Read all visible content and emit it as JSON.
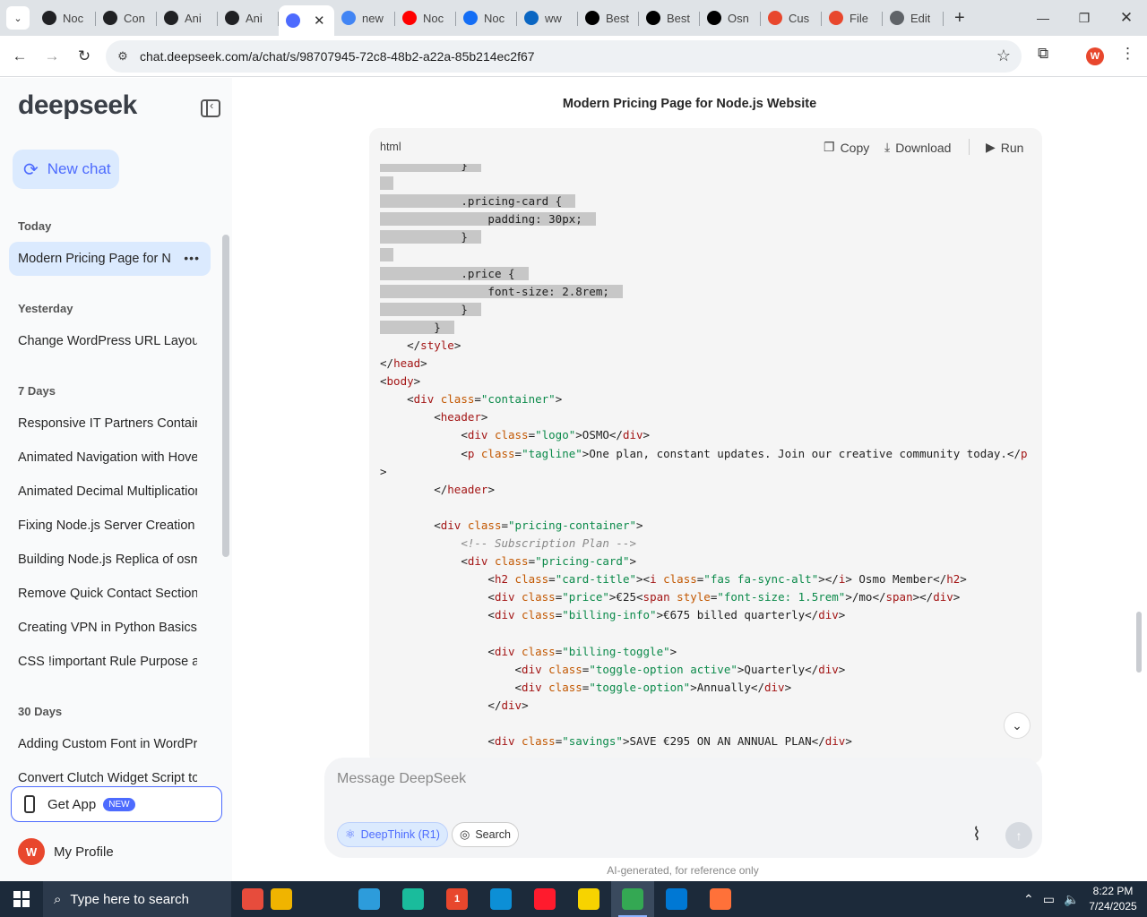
{
  "browser": {
    "tabs": [
      {
        "label": "Noc",
        "icon": "openai-icon",
        "color": "#202124"
      },
      {
        "label": "Con",
        "icon": "openai-icon",
        "color": "#202124"
      },
      {
        "label": "Ani",
        "icon": "openai-icon",
        "color": "#202124"
      },
      {
        "label": "Ani",
        "icon": "openai-icon",
        "color": "#202124"
      },
      {
        "label": "",
        "icon": "deepseek-icon",
        "color": "#4d6bfe",
        "active": true
      },
      {
        "label": "new",
        "icon": "google-icon",
        "color": "#4285f4"
      },
      {
        "label": "Noc",
        "icon": "youtube-icon",
        "color": "#ff0000"
      },
      {
        "label": "Noc",
        "icon": "webflow-icon",
        "color": "#146ef5"
      },
      {
        "label": "ww",
        "icon": "linkedin-icon",
        "color": "#0a66c2"
      },
      {
        "label": "Best",
        "icon": "x-icon",
        "color": "#000000"
      },
      {
        "label": "Best",
        "icon": "x-icon",
        "color": "#000000"
      },
      {
        "label": "Osn",
        "icon": "osmo-icon",
        "color": "#000000"
      },
      {
        "label": "Cus",
        "icon": "figma-icon",
        "color": "#e8472d"
      },
      {
        "label": "File",
        "icon": "figma-icon",
        "color": "#e8472d"
      },
      {
        "label": "Edit",
        "icon": "globe-icon",
        "color": "#5f6368"
      }
    ],
    "url": "chat.deepseek.com/a/chat/s/98707945-72c8-48b2-a22a-85b214ec2f67",
    "profile_initial": "W"
  },
  "sidebar": {
    "brand": "deepseek",
    "new_chat": "New chat",
    "sections": [
      {
        "title": "Today",
        "items": [
          "Modern Pricing Page for Node.js Website"
        ]
      },
      {
        "title": "Yesterday",
        "items": [
          "Change WordPress URL Layout Guide"
        ]
      },
      {
        "title": "7 Days",
        "items": [
          "Responsive IT Partners Container",
          "Animated Navigation with Hover",
          "Animated Decimal Multiplication",
          "Fixing Node.js Server Creation Error",
          "Building Node.js Replica of osmo",
          "Remove Quick Contact Section in",
          "Creating VPN in Python Basics",
          "CSS !important Rule Purpose and"
        ]
      },
      {
        "title": "30 Days",
        "items": [
          "Adding Custom Font in WordPress",
          "Convert Clutch Widget Script to"
        ]
      }
    ],
    "active_item": "Modern Pricing Page for Node.js Website",
    "get_app": "Get App",
    "get_app_badge": "NEW",
    "profile_name": "My Profile",
    "profile_initial": "W"
  },
  "main": {
    "title": "Modern Pricing Page for Node.js Website",
    "code": {
      "language": "html",
      "copy": "Copy",
      "download": "Download",
      "run": "Run",
      "lines": [
        {
          "indent": 12,
          "sel": true,
          "tokens": [
            {
              "t": "}",
              "c": ""
            }
          ]
        },
        {
          "indent": 0,
          "sel": true,
          "tokens": [
            {
              "t": "",
              "c": ""
            }
          ]
        },
        {
          "indent": 12,
          "sel": true,
          "tokens": [
            {
              "t": ".pricing-card {",
              "c": ""
            }
          ]
        },
        {
          "indent": 16,
          "sel": true,
          "tokens": [
            {
              "t": "padding: 30px;",
              "c": ""
            }
          ]
        },
        {
          "indent": 12,
          "sel": true,
          "tokens": [
            {
              "t": "}",
              "c": ""
            }
          ]
        },
        {
          "indent": 0,
          "sel": true,
          "tokens": [
            {
              "t": "",
              "c": ""
            }
          ]
        },
        {
          "indent": 12,
          "sel": true,
          "tokens": [
            {
              "t": ".price {",
              "c": ""
            }
          ]
        },
        {
          "indent": 16,
          "sel": true,
          "tokens": [
            {
              "t": "font-size: 2.8rem;",
              "c": ""
            }
          ]
        },
        {
          "indent": 12,
          "sel": true,
          "tokens": [
            {
              "t": "}",
              "c": ""
            }
          ]
        },
        {
          "indent": 8,
          "sel": true,
          "tokens": [
            {
              "t": "}",
              "c": ""
            }
          ]
        },
        {
          "indent": 4,
          "tokens": [
            {
              "t": "</",
              "c": ""
            },
            {
              "t": "style",
              "c": "tg"
            },
            {
              "t": ">",
              "c": ""
            }
          ]
        },
        {
          "indent": 0,
          "tokens": [
            {
              "t": "</",
              "c": ""
            },
            {
              "t": "head",
              "c": "tg"
            },
            {
              "t": ">",
              "c": ""
            }
          ]
        },
        {
          "indent": 0,
          "tokens": [
            {
              "t": "<",
              "c": ""
            },
            {
              "t": "body",
              "c": "tg"
            },
            {
              "t": ">",
              "c": ""
            }
          ]
        },
        {
          "indent": 4,
          "tokens": [
            {
              "t": "<",
              "c": ""
            },
            {
              "t": "div",
              "c": "tg"
            },
            {
              "t": " class",
              "c": "at"
            },
            {
              "t": "=",
              "c": ""
            },
            {
              "t": "\"container\"",
              "c": "st"
            },
            {
              "t": ">",
              "c": ""
            }
          ]
        },
        {
          "indent": 8,
          "tokens": [
            {
              "t": "<",
              "c": ""
            },
            {
              "t": "header",
              "c": "tg"
            },
            {
              "t": ">",
              "c": ""
            }
          ]
        },
        {
          "indent": 12,
          "tokens": [
            {
              "t": "<",
              "c": ""
            },
            {
              "t": "div",
              "c": "tg"
            },
            {
              "t": " class",
              "c": "at"
            },
            {
              "t": "=",
              "c": ""
            },
            {
              "t": "\"logo\"",
              "c": "st"
            },
            {
              "t": ">OSMO</",
              "c": ""
            },
            {
              "t": "div",
              "c": "tg"
            },
            {
              "t": ">",
              "c": ""
            }
          ]
        },
        {
          "indent": 12,
          "tokens": [
            {
              "t": "<",
              "c": ""
            },
            {
              "t": "p",
              "c": "tg"
            },
            {
              "t": " class",
              "c": "at"
            },
            {
              "t": "=",
              "c": ""
            },
            {
              "t": "\"tagline\"",
              "c": "st"
            },
            {
              "t": ">One plan, constant updates. Join our creative community today.</",
              "c": ""
            },
            {
              "t": "p",
              "c": "tg"
            }
          ]
        },
        {
          "indent": 0,
          "tokens": [
            {
              "t": ">",
              "c": ""
            }
          ]
        },
        {
          "indent": 8,
          "tokens": [
            {
              "t": "</",
              "c": ""
            },
            {
              "t": "header",
              "c": "tg"
            },
            {
              "t": ">",
              "c": ""
            }
          ]
        },
        {
          "indent": 0,
          "tokens": [
            {
              "t": "",
              "c": ""
            }
          ]
        },
        {
          "indent": 8,
          "tokens": [
            {
              "t": "<",
              "c": ""
            },
            {
              "t": "div",
              "c": "tg"
            },
            {
              "t": " class",
              "c": "at"
            },
            {
              "t": "=",
              "c": ""
            },
            {
              "t": "\"pricing-container\"",
              "c": "st"
            },
            {
              "t": ">",
              "c": ""
            }
          ]
        },
        {
          "indent": 12,
          "tokens": [
            {
              "t": "<!-- Subscription Plan -->",
              "c": "cm"
            }
          ]
        },
        {
          "indent": 12,
          "tokens": [
            {
              "t": "<",
              "c": ""
            },
            {
              "t": "div",
              "c": "tg"
            },
            {
              "t": " class",
              "c": "at"
            },
            {
              "t": "=",
              "c": ""
            },
            {
              "t": "\"pricing-card\"",
              "c": "st"
            },
            {
              "t": ">",
              "c": ""
            }
          ]
        },
        {
          "indent": 16,
          "tokens": [
            {
              "t": "<",
              "c": ""
            },
            {
              "t": "h2",
              "c": "tg"
            },
            {
              "t": " class",
              "c": "at"
            },
            {
              "t": "=",
              "c": ""
            },
            {
              "t": "\"card-title\"",
              "c": "st"
            },
            {
              "t": "><",
              "c": ""
            },
            {
              "t": "i",
              "c": "tg"
            },
            {
              "t": " class",
              "c": "at"
            },
            {
              "t": "=",
              "c": ""
            },
            {
              "t": "\"fas fa-sync-alt\"",
              "c": "st"
            },
            {
              "t": "></",
              "c": ""
            },
            {
              "t": "i",
              "c": "tg"
            },
            {
              "t": "> Osmo Member</",
              "c": ""
            },
            {
              "t": "h2",
              "c": "tg"
            },
            {
              "t": ">",
              "c": ""
            }
          ]
        },
        {
          "indent": 16,
          "tokens": [
            {
              "t": "<",
              "c": ""
            },
            {
              "t": "div",
              "c": "tg"
            },
            {
              "t": " class",
              "c": "at"
            },
            {
              "t": "=",
              "c": ""
            },
            {
              "t": "\"price\"",
              "c": "st"
            },
            {
              "t": ">€25<",
              "c": ""
            },
            {
              "t": "span",
              "c": "tg"
            },
            {
              "t": " style",
              "c": "at"
            },
            {
              "t": "=",
              "c": ""
            },
            {
              "t": "\"font-size: 1.5rem\"",
              "c": "st"
            },
            {
              "t": ">/mo</",
              "c": ""
            },
            {
              "t": "span",
              "c": "tg"
            },
            {
              "t": "></",
              "c": ""
            },
            {
              "t": "div",
              "c": "tg"
            },
            {
              "t": ">",
              "c": ""
            }
          ]
        },
        {
          "indent": 16,
          "tokens": [
            {
              "t": "<",
              "c": ""
            },
            {
              "t": "div",
              "c": "tg"
            },
            {
              "t": " class",
              "c": "at"
            },
            {
              "t": "=",
              "c": ""
            },
            {
              "t": "\"billing-info\"",
              "c": "st"
            },
            {
              "t": ">€675 billed quarterly</",
              "c": ""
            },
            {
              "t": "div",
              "c": "tg"
            },
            {
              "t": ">",
              "c": ""
            }
          ]
        },
        {
          "indent": 0,
          "tokens": [
            {
              "t": "",
              "c": ""
            }
          ]
        },
        {
          "indent": 16,
          "tokens": [
            {
              "t": "<",
              "c": ""
            },
            {
              "t": "div",
              "c": "tg"
            },
            {
              "t": " class",
              "c": "at"
            },
            {
              "t": "=",
              "c": ""
            },
            {
              "t": "\"billing-toggle\"",
              "c": "st"
            },
            {
              "t": ">",
              "c": ""
            }
          ]
        },
        {
          "indent": 20,
          "tokens": [
            {
              "t": "<",
              "c": ""
            },
            {
              "t": "div",
              "c": "tg"
            },
            {
              "t": " class",
              "c": "at"
            },
            {
              "t": "=",
              "c": ""
            },
            {
              "t": "\"toggle-option active\"",
              "c": "st"
            },
            {
              "t": ">Quarterly</",
              "c": ""
            },
            {
              "t": "div",
              "c": "tg"
            },
            {
              "t": ">",
              "c": ""
            }
          ]
        },
        {
          "indent": 20,
          "tokens": [
            {
              "t": "<",
              "c": ""
            },
            {
              "t": "div",
              "c": "tg"
            },
            {
              "t": " class",
              "c": "at"
            },
            {
              "t": "=",
              "c": ""
            },
            {
              "t": "\"toggle-option\"",
              "c": "st"
            },
            {
              "t": ">Annually</",
              "c": ""
            },
            {
              "t": "div",
              "c": "tg"
            },
            {
              "t": ">",
              "c": ""
            }
          ]
        },
        {
          "indent": 16,
          "tokens": [
            {
              "t": "</",
              "c": ""
            },
            {
              "t": "div",
              "c": "tg"
            },
            {
              "t": ">",
              "c": ""
            }
          ]
        },
        {
          "indent": 0,
          "tokens": [
            {
              "t": "",
              "c": ""
            }
          ]
        },
        {
          "indent": 16,
          "tokens": [
            {
              "t": "<",
              "c": ""
            },
            {
              "t": "div",
              "c": "tg"
            },
            {
              "t": " class",
              "c": "at"
            },
            {
              "t": "=",
              "c": ""
            },
            {
              "t": "\"savings\"",
              "c": "st"
            },
            {
              "t": ">SAVE €295 ON AN ANNUAL PLAN</",
              "c": ""
            },
            {
              "t": "div",
              "c": "tg"
            },
            {
              "t": ">",
              "c": ""
            }
          ]
        }
      ]
    },
    "composer": {
      "placeholder": "Message DeepSeek",
      "deepthink": "DeepThink (R1)",
      "search": "Search"
    },
    "disclaimer": "AI-generated, for reference only"
  },
  "taskbar": {
    "search_placeholder": "Type here to search",
    "apps": [
      {
        "name": "tools-app",
        "color": "#e74c3c"
      },
      {
        "name": "explorer-app",
        "color": "#f0b400"
      },
      {
        "name": "snip-app",
        "color": "#2d9cdb"
      },
      {
        "name": "app-diamond",
        "color": "#1abc9c"
      },
      {
        "name": "zoom-app",
        "color": "#e8472d",
        "badge": "1"
      },
      {
        "name": "edge-app",
        "color": "#0c8fd6"
      },
      {
        "name": "opera-app",
        "color": "#ff1b2d"
      },
      {
        "name": "sticky-notes-app",
        "color": "#f7d300"
      },
      {
        "name": "chrome-app",
        "color": "#34a853",
        "active": true
      },
      {
        "name": "vscode-app",
        "color": "#0078d4"
      },
      {
        "name": "firefox-app",
        "color": "#ff7139"
      }
    ],
    "time": "8:22 PM",
    "date": "7/24/2025"
  }
}
